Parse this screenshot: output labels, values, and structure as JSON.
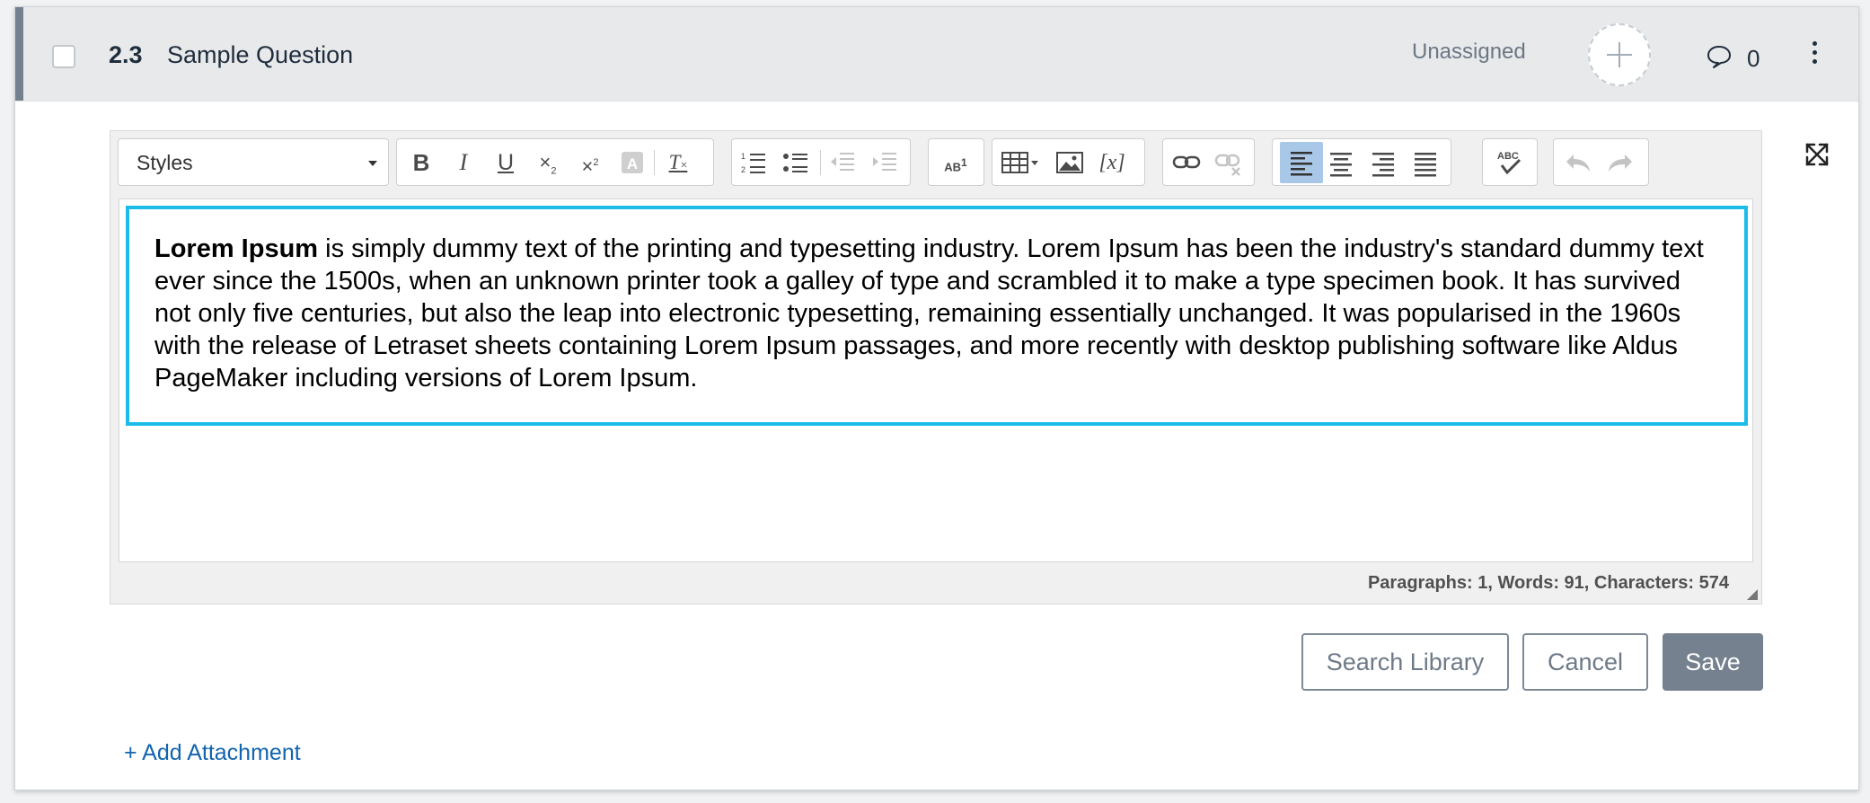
{
  "question": {
    "number": "2.3",
    "title": "Sample Question",
    "assignee": "Unassigned",
    "comment_count": "0"
  },
  "toolbar": {
    "styles_label": "Styles",
    "buttons": [
      {
        "name": "bold",
        "state": "enabled"
      },
      {
        "name": "italic",
        "state": "enabled"
      },
      {
        "name": "underline",
        "state": "enabled"
      },
      {
        "name": "subscript",
        "state": "enabled"
      },
      {
        "name": "superscript",
        "state": "enabled"
      },
      {
        "name": "text-color",
        "state": "disabled"
      },
      {
        "name": "remove-format",
        "state": "enabled"
      },
      {
        "name": "numbered-list",
        "state": "enabled"
      },
      {
        "name": "bulleted-list",
        "state": "enabled"
      },
      {
        "name": "decrease-indent",
        "state": "disabled"
      },
      {
        "name": "increase-indent",
        "state": "disabled"
      },
      {
        "name": "language-marker",
        "state": "enabled"
      },
      {
        "name": "table",
        "state": "enabled"
      },
      {
        "name": "image",
        "state": "enabled"
      },
      {
        "name": "formula",
        "state": "enabled"
      },
      {
        "name": "link",
        "state": "enabled"
      },
      {
        "name": "unlink",
        "state": "disabled"
      },
      {
        "name": "align-left",
        "state": "active"
      },
      {
        "name": "align-center",
        "state": "enabled"
      },
      {
        "name": "align-right",
        "state": "enabled"
      },
      {
        "name": "align-justify",
        "state": "enabled"
      },
      {
        "name": "spell-check",
        "state": "enabled"
      },
      {
        "name": "undo",
        "state": "disabled"
      },
      {
        "name": "redo",
        "state": "disabled"
      }
    ]
  },
  "editor": {
    "bold_lead": "Lorem Ipsum",
    "body": " is simply dummy text of the printing and typesetting industry. Lorem Ipsum has been the industry's standard dummy text ever since the 1500s, when an unknown printer took a galley of type and scrambled it to make a type specimen book. It has survived not only five centuries, but also the leap into electronic typesetting, remaining essentially unchanged. It was popularised in the 1960s with the release of Letraset sheets containing Lorem Ipsum passages, and more recently with desktop publishing software like Aldus PageMaker including versions of Lorem Ipsum.",
    "status": "Paragraphs: 1, Words: 91, Characters: 574"
  },
  "actions": {
    "search_library": "Search Library",
    "cancel": "Cancel",
    "save": "Save"
  },
  "add_attachment": "+ Add Attachment",
  "colors": {
    "focus_border": "#1bbde8",
    "save_button": "#75818f",
    "link": "#1164ae",
    "header_bg": "#e8e9ea"
  }
}
